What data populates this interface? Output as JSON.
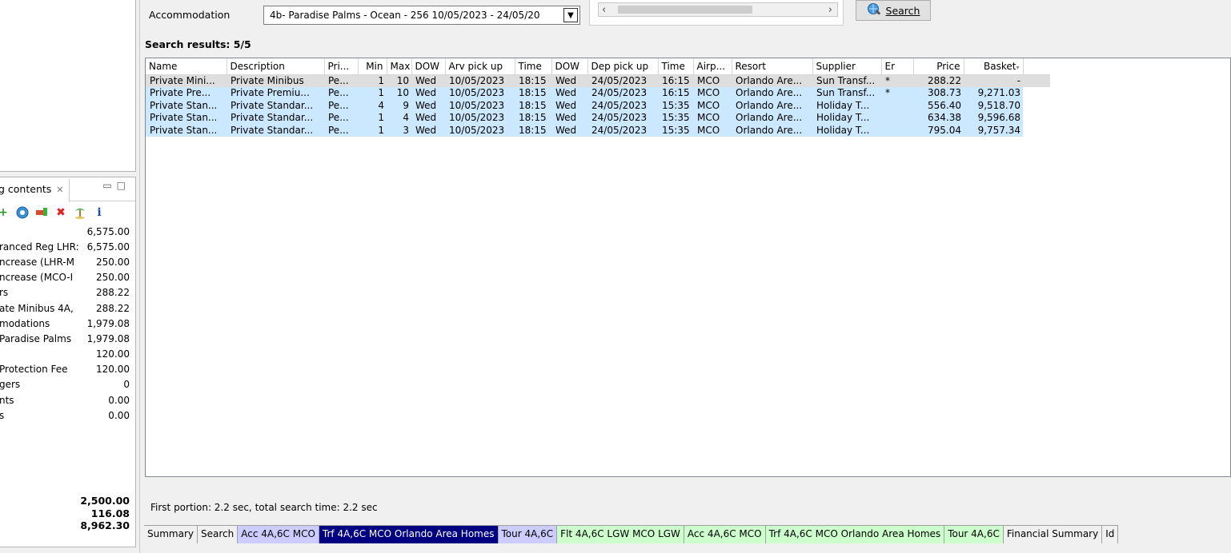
{
  "form": {
    "accommodation_label": "Accommodation",
    "accommodation_value": "4b- Paradise Palms - Ocean - 256 10/05/2023 - 24/05/20",
    "search_label": "Search"
  },
  "results": {
    "label": "Search results: 5/5",
    "columns": [
      "Name",
      "Description",
      "Pri...",
      "Min",
      "Max",
      "DOW",
      "Arv pick up",
      "Time",
      "DOW",
      "Dep pick up",
      "Time",
      "Airp...",
      "Resort",
      "Supplier",
      "Er",
      "Price",
      "Basket"
    ],
    "rows": [
      [
        "Private Mini...",
        "Private Minibus",
        "Pe...",
        "1",
        "10",
        "Wed",
        "10/05/2023",
        "18:15",
        "Wed",
        "24/05/2023",
        "16:15",
        "MCO",
        "Orlando Are...",
        "Sun Transf...",
        "*",
        "288.22",
        "-"
      ],
      [
        "Private Pre...",
        "Private Premiu...",
        "Pe...",
        "1",
        "10",
        "Wed",
        "10/05/2023",
        "18:15",
        "Wed",
        "24/05/2023",
        "16:15",
        "MCO",
        "Orlando Are...",
        "Sun Transf...",
        "*",
        "308.73",
        "9,271.03"
      ],
      [
        "Private Stan...",
        "Private Standar...",
        "Pe...",
        "4",
        "9",
        "Wed",
        "10/05/2023",
        "18:15",
        "Wed",
        "24/05/2023",
        "15:35",
        "MCO",
        "Orlando Are...",
        "Holiday T...",
        "",
        "556.40",
        "9,518.70"
      ],
      [
        "Private Stan...",
        "Private Standar...",
        "Pe...",
        "1",
        "4",
        "Wed",
        "10/05/2023",
        "18:15",
        "Wed",
        "24/05/2023",
        "15:35",
        "MCO",
        "Orlando Are...",
        "Holiday T...",
        "",
        "634.38",
        "9,596.68"
      ],
      [
        "Private Stan...",
        "Private Standar...",
        "Pe...",
        "1",
        "3",
        "Wed",
        "10/05/2023",
        "18:15",
        "Wed",
        "24/05/2023",
        "15:35",
        "MCO",
        "Orlando Are...",
        "Holiday T...",
        "",
        "795.04",
        "9,757.34"
      ]
    ],
    "status": "First portion: 2.2 sec, total search time: 2.2 sec"
  },
  "left_panel": {
    "tab_label": "g contents",
    "items": [
      {
        "label": "",
        "value": "6,575.00"
      },
      {
        "label": "ranced Reg LHR:",
        "value": "6,575.00"
      },
      {
        "label": "ncrease (LHR-M",
        "value": "250.00"
      },
      {
        "label": "ncrease (MCO-I",
        "value": "250.00"
      },
      {
        "label": "rs",
        "value": "288.22"
      },
      {
        "label": "ate Minibus 4A,",
        "value": "288.22"
      },
      {
        "label": "modations",
        "value": "1,979.08"
      },
      {
        "label": "Paradise Palms",
        "value": "1,979.08"
      },
      {
        "label": "",
        "value": "120.00"
      },
      {
        "label": "Protection Fee",
        "value": "120.00"
      },
      {
        "label": "gers",
        "value": "0"
      },
      {
        "label": "nts",
        "value": "0.00"
      },
      {
        "label": "s",
        "value": "0.00"
      }
    ],
    "totals": [
      "2,500.00",
      "116.08",
      "8,962.30"
    ]
  },
  "bottom_tabs": [
    {
      "label": "Summary",
      "style": "plain"
    },
    {
      "label": "Search",
      "style": "plain"
    },
    {
      "label": "Acc 4A,6C MCO",
      "style": "purple"
    },
    {
      "label": "Trf 4A,6C MCO Orlando Area Homes",
      "style": "active"
    },
    {
      "label": "Tour 4A,6C",
      "style": "purple"
    },
    {
      "label": "Flt 4A,6C LGW MCO LGW",
      "style": "green"
    },
    {
      "label": "Acc 4A,6C MCO",
      "style": "green"
    },
    {
      "label": "Trf 4A,6C MCO Orlando Area Homes",
      "style": "green"
    },
    {
      "label": "Tour 4A,6C",
      "style": "green"
    },
    {
      "label": "Financial Summary",
      "style": "plain"
    },
    {
      "label": "Id",
      "style": "plain"
    }
  ],
  "colors": {
    "selection": "#cce8ff",
    "active_tab": "#000080",
    "purple_tab": "#ccccff",
    "green_tab": "#ccffcc"
  }
}
